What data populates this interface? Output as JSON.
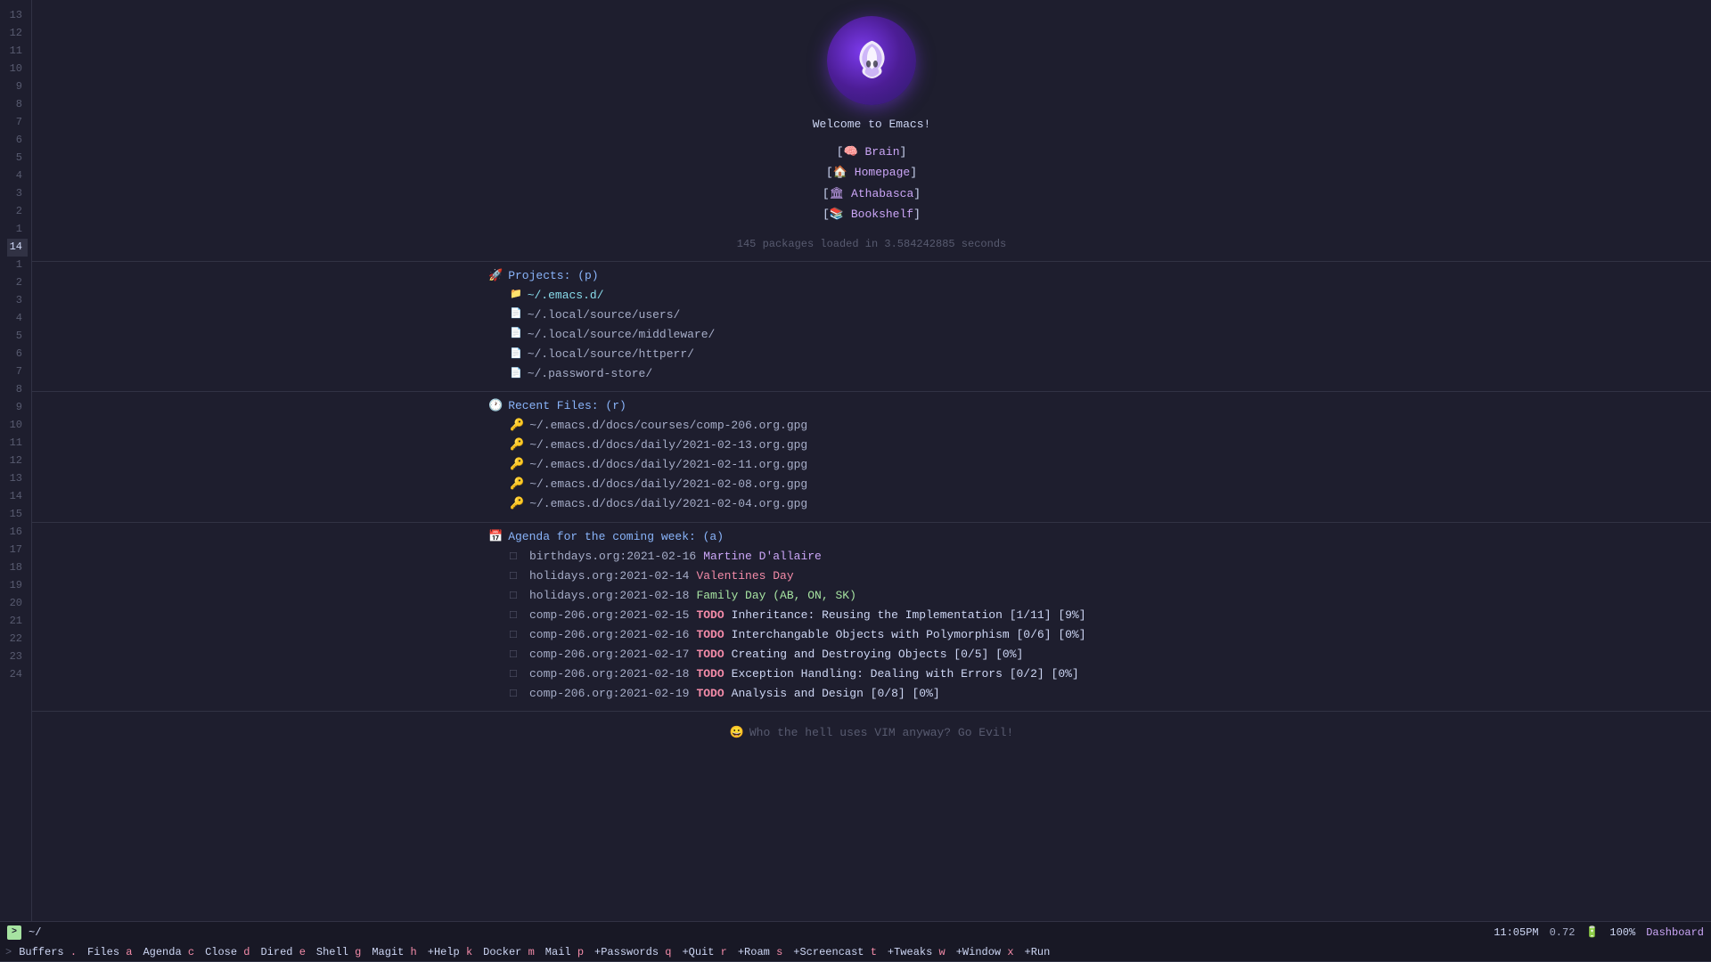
{
  "app": {
    "title": "Emacs",
    "welcome": "Welcome to Emacs!"
  },
  "logo": {
    "alt": "Emacs logo"
  },
  "nav_links": [
    {
      "label": "Brain",
      "icon": "🧠"
    },
    {
      "label": "Homepage",
      "icon": "🏠"
    },
    {
      "label": "Athabasca",
      "icon": "🏛"
    },
    {
      "label": "Bookshelf",
      "icon": "📚"
    }
  ],
  "packages_text": "145 packages loaded in 3.584242885 seconds",
  "projects": {
    "header": "Projects: (p)",
    "items": [
      "~/.emacs.d/",
      "~/.local/source/users/",
      "~/.local/source/middleware/",
      "~/.local/source/httperr/",
      "~/.password-store/"
    ]
  },
  "recent_files": {
    "header": "Recent Files: (r)",
    "items": [
      "~/.emacs.d/docs/courses/comp-206.org.gpg",
      "~/.emacs.d/docs/daily/2021-02-13.org.gpg",
      "~/.emacs.d/docs/daily/2021-02-11.org.gpg",
      "~/.emacs.d/docs/daily/2021-02-08.org.gpg",
      "~/.emacs.d/docs/daily/2021-02-04.org.gpg"
    ]
  },
  "agenda": {
    "header": "Agenda for the coming week: (a)",
    "items": [
      {
        "date": "birthdays.org:2021-02-16",
        "event": "Martine D'allaire",
        "type": "birthday"
      },
      {
        "date": "holidays.org:2021-02-14",
        "event": "Valentines Day",
        "type": "holiday"
      },
      {
        "date": "holidays.org:2021-02-18",
        "event": "Family Day (AB, ON, SK)",
        "type": "holiday-green"
      },
      {
        "date": "comp-206.org:2021-02-15",
        "todo": "TODO",
        "event": "Inheritance: Reusing the Implementation [1/11] [9%]",
        "type": "todo"
      },
      {
        "date": "comp-206.org:2021-02-16",
        "todo": "TODO",
        "event": "Interchangable Objects with Polymorphism [0/6] [0%]",
        "type": "todo"
      },
      {
        "date": "comp-206.org:2021-02-17",
        "todo": "TODO",
        "event": "Creating and Destroying Objects [0/5] [0%]",
        "type": "todo"
      },
      {
        "date": "comp-206.org:2021-02-18",
        "todo": "TODO",
        "event": "Exception Handling: Dealing with Errors [0/2] [0%]",
        "type": "todo"
      },
      {
        "date": "comp-206.org:2021-02-19",
        "todo": "TODO",
        "event": "Analysis and Design [0/8] [0%]",
        "type": "todo"
      }
    ]
  },
  "evil_text": "Who the hell uses VIM anyway? Go Evil!",
  "line_numbers": [
    "13",
    "12",
    "11",
    "10",
    "9",
    "8",
    "7",
    "6",
    "5",
    "4",
    "3",
    "2",
    "1",
    "14",
    "1",
    "2",
    "3",
    "4",
    "5",
    "6",
    "7",
    "8",
    "9",
    "10",
    "11",
    "12",
    "13",
    "14",
    "15",
    "16",
    "17",
    "18",
    "19",
    "20",
    "21",
    "22",
    "23",
    "24"
  ],
  "current_line": 14,
  "status_bar": {
    "indicator": ">",
    "path": "~/",
    "time": "11:05PM",
    "load": "0.72",
    "battery_icon": "🔋",
    "battery_pct": "100%",
    "dashboard": "Dashboard"
  },
  "menu_bar": [
    {
      "label": "Buffers",
      "key": "."
    },
    {
      "label": "Files",
      "key": "a"
    },
    {
      "label": "Agenda",
      "key": "c"
    },
    {
      "label": "Close",
      "key": "d"
    },
    {
      "label": "Dired",
      "key": "e"
    },
    {
      "label": "Shell",
      "key": "g"
    },
    {
      "label": "Magit",
      "key": "h"
    },
    {
      "label": "+Help",
      "key": "k"
    },
    {
      "label": "Docker",
      "key": "m"
    },
    {
      "label": "Mail",
      "key": "p"
    },
    {
      "label": "+Passwords",
      "key": "q"
    },
    {
      "label": "+Quit",
      "key": "r"
    },
    {
      "label": "+Roam",
      "key": "s"
    },
    {
      "label": "+Screencast",
      "key": "t"
    },
    {
      "label": "+Tweaks",
      "key": "w"
    },
    {
      "label": "+Window",
      "key": "x"
    },
    {
      "label": "+Run",
      "key": ""
    }
  ]
}
